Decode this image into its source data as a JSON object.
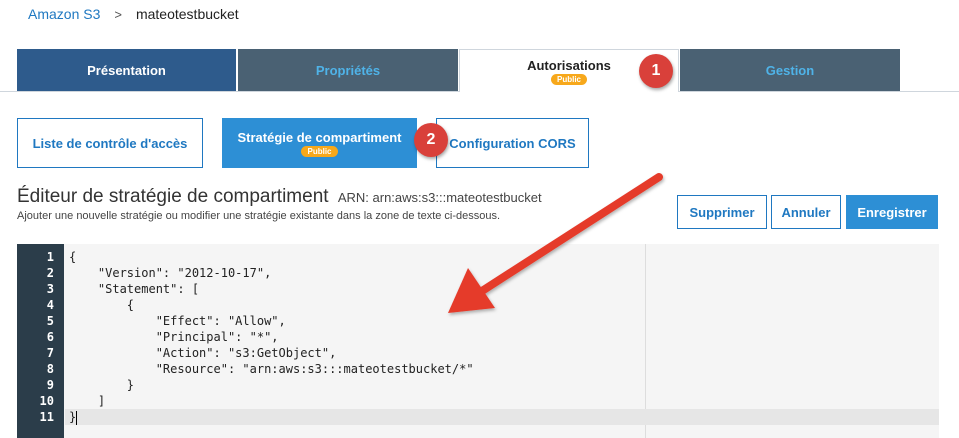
{
  "breadcrumb": {
    "root": "Amazon S3",
    "separator": ">",
    "current": "mateotestbucket"
  },
  "tabs": [
    {
      "label": "Présentation"
    },
    {
      "label": "Propriétés"
    },
    {
      "label": "Autorisations",
      "badge": "Public",
      "selected": true
    },
    {
      "label": "Gestion"
    }
  ],
  "subtabs": [
    {
      "label": "Liste de contrôle d'accès"
    },
    {
      "label": "Stratégie de compartiment",
      "badge": "Public",
      "selected": true
    },
    {
      "label": "Configuration CORS"
    }
  ],
  "markers": [
    "1",
    "2"
  ],
  "editor": {
    "title": "Éditeur de stratégie de compartiment",
    "arn": "ARN: arn:aws:s3:::mateotestbucket",
    "description": "Ajouter une nouvelle stratégie ou modifier une stratégie existante dans la zone de texte ci-dessous.",
    "buttons": {
      "delete": "Supprimer",
      "cancel": "Annuler",
      "save": "Enregistrer"
    }
  },
  "code": {
    "line_numbers": [
      "1",
      "2",
      "3",
      "4",
      "5",
      "6",
      "7",
      "8",
      "9",
      "10",
      "11"
    ],
    "lines": [
      "{",
      "    \"Version\": \"2012-10-17\",",
      "    \"Statement\": [",
      "        {",
      "            \"Effect\": \"Allow\",",
      "            \"Principal\": \"*\",",
      "            \"Action\": \"s3:GetObject\",",
      "            \"Resource\": \"arn:aws:s3:::mateotestbucket/*\"",
      "        }",
      "    ]",
      "}"
    ],
    "active_line": 11
  },
  "colors": {
    "annotation_red": "#d9403a",
    "badge_orange": "#f7a81b",
    "primary_blue": "#2d8fd5"
  }
}
